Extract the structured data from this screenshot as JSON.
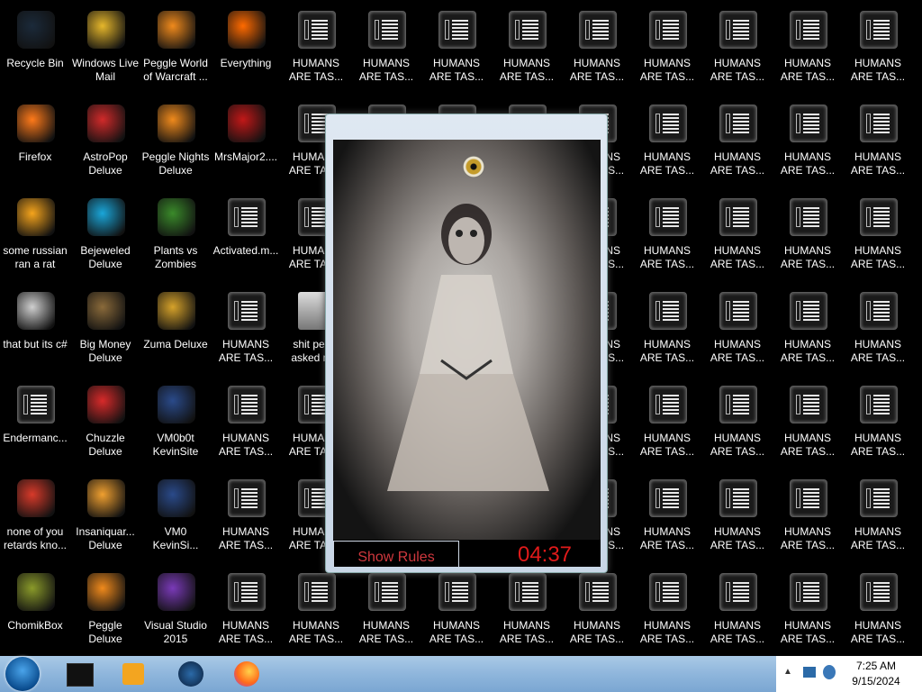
{
  "desktop": {
    "icons": [
      {
        "label": "Recycle Bin",
        "icon": "recycle-bin-icon",
        "col": 0,
        "row": 0
      },
      {
        "label": "Windows Live Mail",
        "icon": "mail-icon",
        "col": 1,
        "row": 0
      },
      {
        "label": "Peggle World of Warcraft ...",
        "icon": "peggle-icon",
        "col": 2,
        "row": 0
      },
      {
        "label": "Everything",
        "icon": "search-icon",
        "col": 3,
        "row": 0
      },
      {
        "label": "Firefox",
        "icon": "firefox-icon",
        "col": 0,
        "row": 1
      },
      {
        "label": "AstroPop Deluxe",
        "icon": "astropop-icon",
        "col": 1,
        "row": 1
      },
      {
        "label": "Peggle Nights Deluxe",
        "icon": "peggle-icon",
        "col": 2,
        "row": 1
      },
      {
        "label": "MrsMajor2....",
        "icon": "ram-skull-icon",
        "col": 3,
        "row": 1
      },
      {
        "label": "some russian ran a rat",
        "icon": "folder-icon",
        "col": 0,
        "row": 2
      },
      {
        "label": "Bejeweled Deluxe",
        "icon": "gem-icon",
        "col": 1,
        "row": 2
      },
      {
        "label": "Plants vs Zombies",
        "icon": "plant-icon",
        "col": 2,
        "row": 2
      },
      {
        "label": "Activated.m...",
        "icon": "file-icon",
        "col": 3,
        "row": 2
      },
      {
        "label": "that but its c#",
        "icon": "copy-icon",
        "col": 0,
        "row": 3
      },
      {
        "label": "Big Money Deluxe",
        "icon": "money-icon",
        "col": 1,
        "row": 3
      },
      {
        "label": "Zuma Deluxe",
        "icon": "zuma-icon",
        "col": 2,
        "row": 3
      },
      {
        "label": "Endermanc...",
        "icon": "file-icon",
        "col": 0,
        "row": 4
      },
      {
        "label": "Chuzzle Deluxe",
        "icon": "chuzzle-icon",
        "col": 1,
        "row": 4
      },
      {
        "label": "VM0b0t KevinSite",
        "icon": "vm-icon",
        "col": 2,
        "row": 4
      },
      {
        "label": "none of you retards kno...",
        "icon": "chrome-icon",
        "col": 0,
        "row": 5
      },
      {
        "label": "Insaniquar... Deluxe",
        "icon": "fish-icon",
        "col": 1,
        "row": 5
      },
      {
        "label": "VM0 KevinSi...",
        "icon": "vm-icon",
        "col": 2,
        "row": 5
      },
      {
        "label": "ChomikBox",
        "icon": "hamster-icon",
        "col": 0,
        "row": 6
      },
      {
        "label": "Peggle Deluxe",
        "icon": "peggle-icon",
        "col": 1,
        "row": 6
      },
      {
        "label": "Visual Studio 2015",
        "icon": "visual-studio-icon",
        "col": 2,
        "row": 6
      }
    ],
    "shit_pec_label": "shit pec... asked m...",
    "humans_label": "HUMANS ARE TAS..."
  },
  "popup": {
    "show_rules_label": "Show Rules",
    "timer": "04:37"
  },
  "taskbar": {
    "time": "7:25 AM",
    "date": "9/15/2024"
  }
}
